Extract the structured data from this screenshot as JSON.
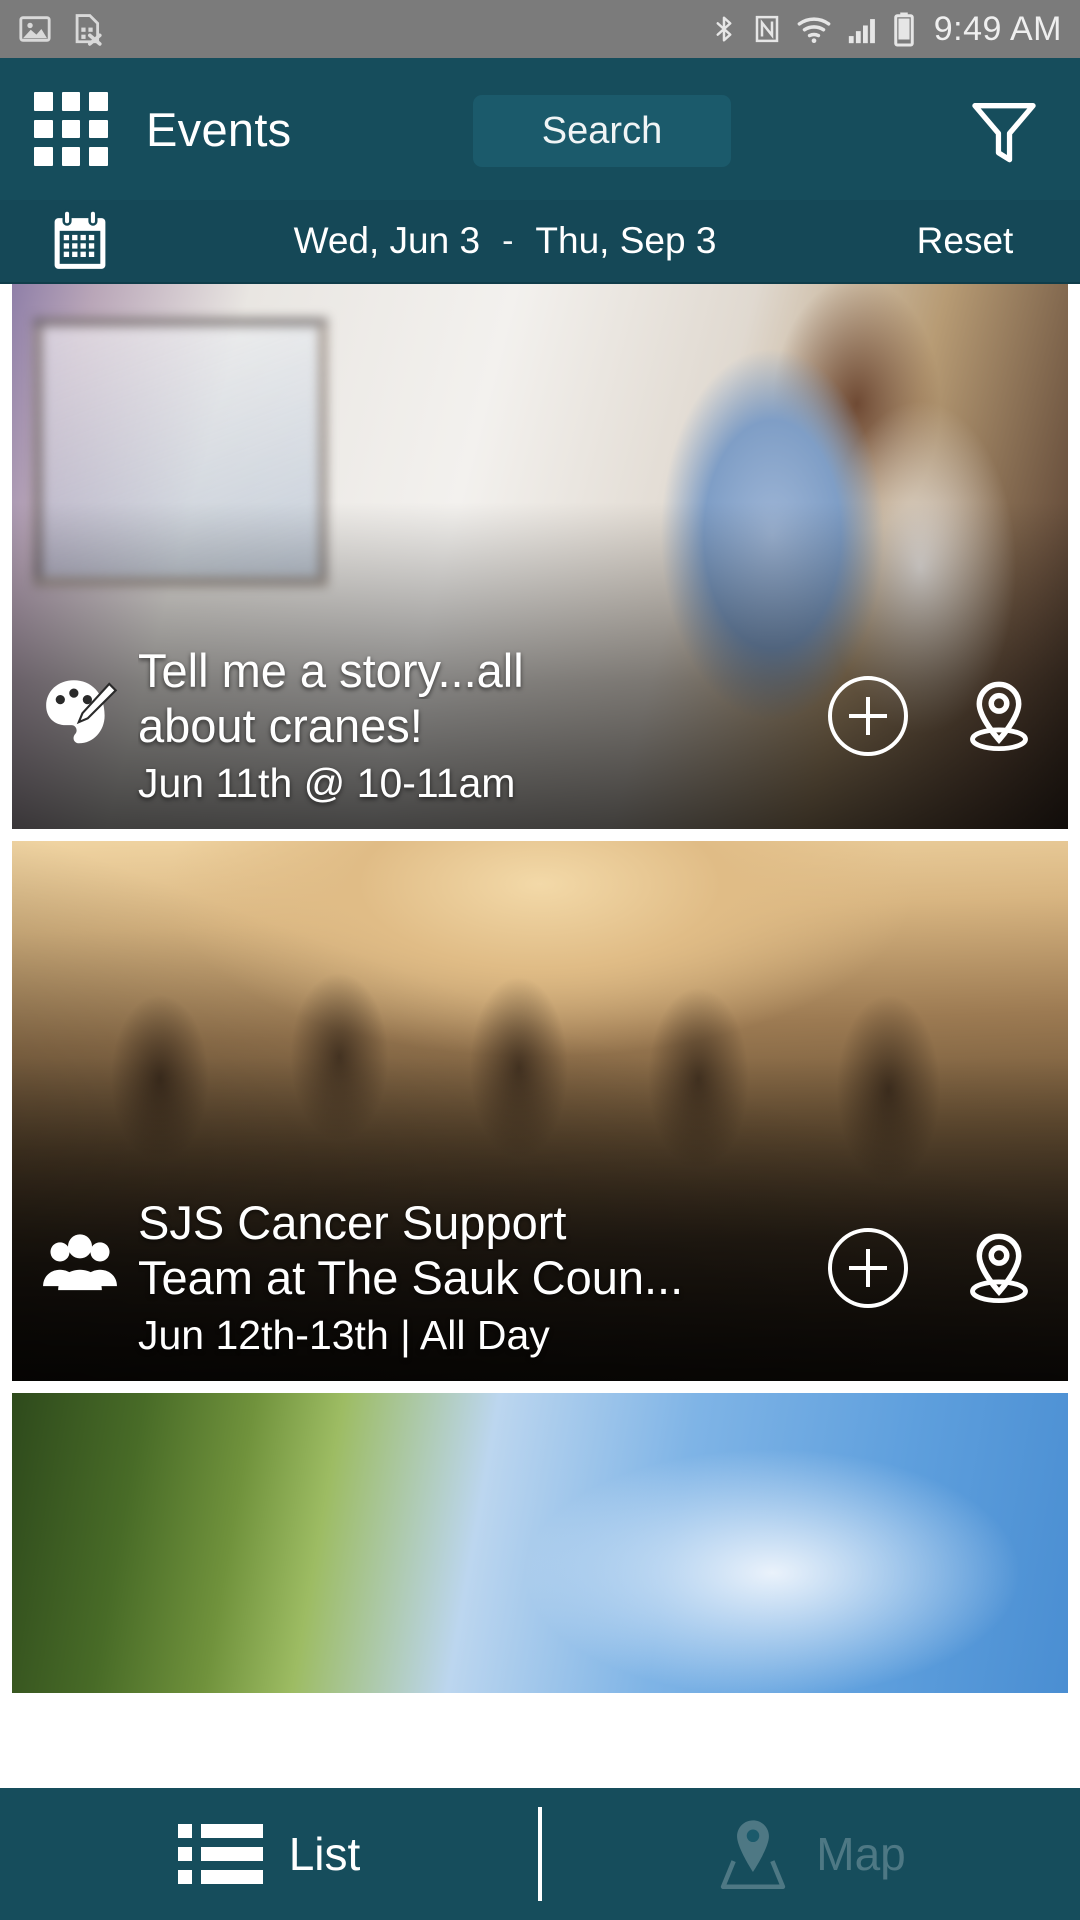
{
  "statusbar": {
    "time": "9:49 AM",
    "left_icons": [
      "image-icon",
      "sim-card-error-icon"
    ],
    "right_icons": [
      "bluetooth-icon",
      "nfc-icon",
      "wifi-icon",
      "cellular-signal-icon",
      "battery-icon"
    ],
    "bg_color": "#7b7b7b"
  },
  "header": {
    "menu_icon": "grid-apps-icon",
    "title": "Events",
    "search_label": "Search",
    "filter_icon": "funnel-filter-icon",
    "bg_color": "#164d5c"
  },
  "datebar": {
    "calendar_icon": "calendar-icon",
    "start_date": "Wed, Jun 3",
    "separator": "-",
    "end_date": "Thu, Sep 3",
    "reset_label": "Reset"
  },
  "events": [
    {
      "category_icon": "paint-palette-icon",
      "title_line1": "Tell me a story...all",
      "title_line2": "about cranes!",
      "date": "Jun 11th @ 10-11am",
      "add_icon": "plus-circle-icon",
      "map_icon": "location-pin-icon",
      "image_alt": "couple-looking-at-paintings-in-gallery"
    },
    {
      "category_icon": "people-group-icon",
      "title_line1": "SJS Cancer Support",
      "title_line2": "Team at The Sauk Coun...",
      "date": "Jun 12th-13th | All Day",
      "add_icon": "plus-circle-icon",
      "map_icon": "location-pin-icon",
      "image_alt": "paper-cutout-people-holding-hands"
    },
    {
      "category_icon": "",
      "title_line1": "",
      "title_line2": "",
      "date": "",
      "add_icon": "",
      "map_icon": "",
      "image_alt": "tree-branches-against-blue-sky"
    }
  ],
  "tabbar": {
    "tabs": [
      {
        "icon": "list-icon",
        "label": "List",
        "active": true
      },
      {
        "icon": "map-pin-icon",
        "label": "Map",
        "active": false
      }
    ],
    "active_color": "#ffffff",
    "inactive_color": "#4e7884"
  }
}
